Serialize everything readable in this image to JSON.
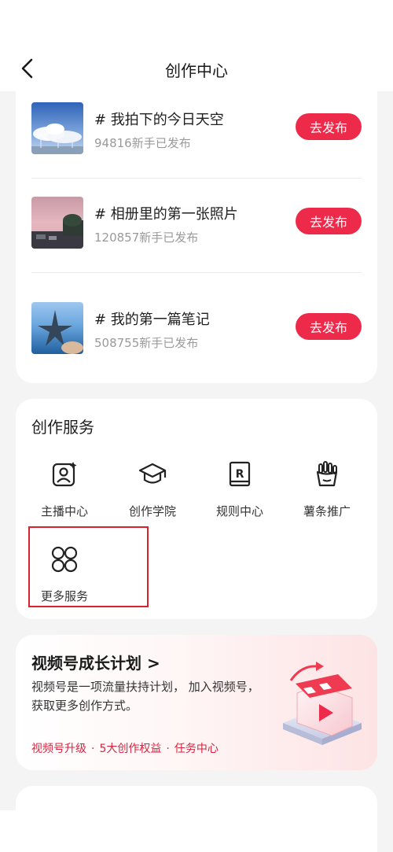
{
  "header": {
    "title": "创作中心",
    "back_icon": "chevron-left-icon"
  },
  "topics": [
    {
      "title": "# 我拍下的今日天空",
      "count": "94816新手已发布",
      "button": "去发布",
      "thumb": "sky-clouds"
    },
    {
      "title": "# 相册里的第一张照片",
      "count": "120857新手已发布",
      "button": "去发布",
      "thumb": "pink-sky-street"
    },
    {
      "title": "# 我的第一篇笔记",
      "count": "508755新手已发布",
      "button": "去发布",
      "thumb": "starfish-sea"
    }
  ],
  "services": {
    "title": "创作服务",
    "items": [
      {
        "label": "主播中心",
        "icon": "anchor-portrait-icon"
      },
      {
        "label": "创作学院",
        "icon": "graduation-cap-icon"
      },
      {
        "label": "规则中心",
        "icon": "rule-book-icon"
      },
      {
        "label": "薯条推广",
        "icon": "fries-icon"
      },
      {
        "label": "更多服务",
        "icon": "four-circles-icon"
      }
    ]
  },
  "growth": {
    "title": "视频号成长计划 >",
    "desc": "视频号是一项流量扶持计划， 加入视频号，获取更多创作方式。",
    "links": [
      "视频号升级",
      "5大创作权益",
      "任务中心"
    ],
    "accent": "#d8233f"
  },
  "colors": {
    "publish_button": "#ee2a4a",
    "highlight_border": "#d8232f"
  }
}
